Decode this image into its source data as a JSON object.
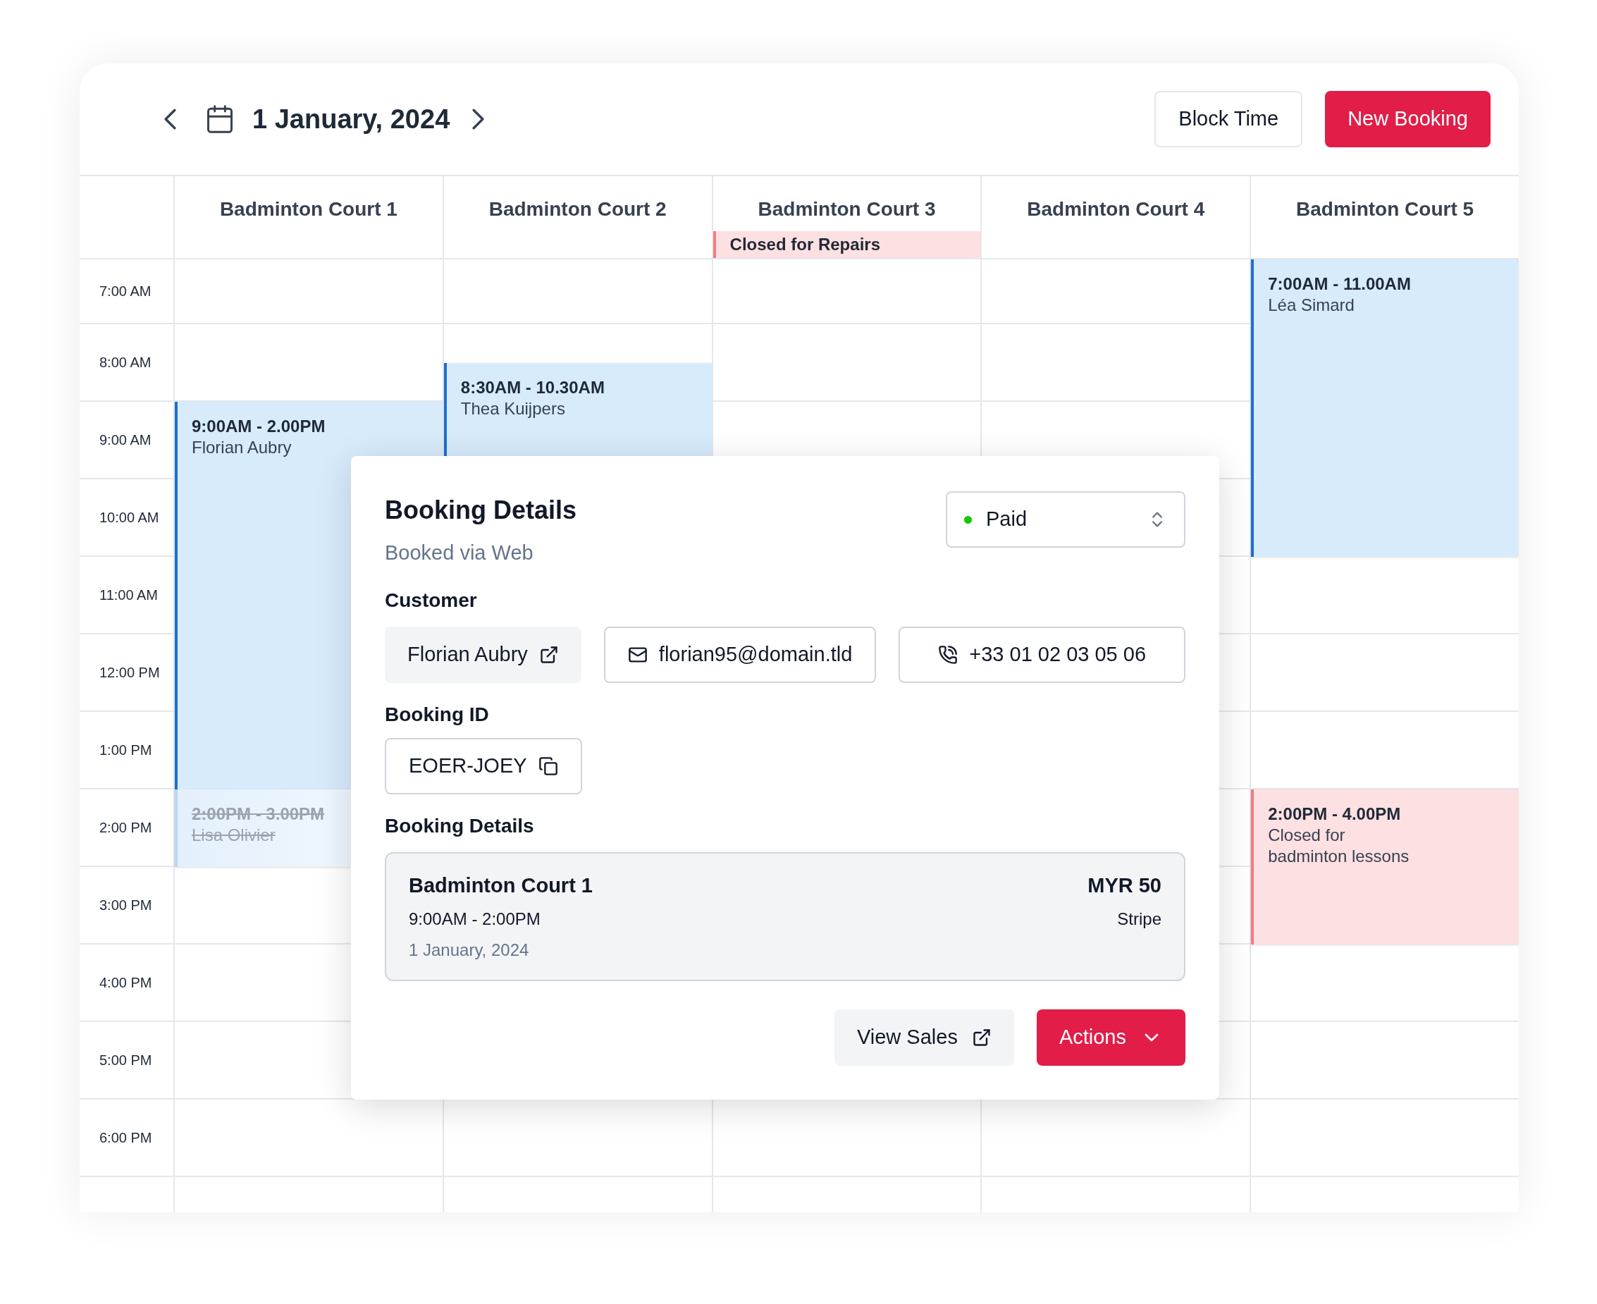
{
  "header": {
    "date": "1 January, 2024",
    "buttons": [
      {
        "label": "Block Time",
        "kind": "secondary"
      },
      {
        "label": "New Booking",
        "kind": "primary"
      }
    ]
  },
  "courts": [
    {
      "name": "Badminton Court 1",
      "bookings": [
        {
          "kind": "booking",
          "time": "9:00AM - 2.00PM",
          "name": "Florian Aubry"
        },
        {
          "kind": "cancelled",
          "time": "2:00PM - 3.00PM",
          "name": "Lisa Olivier"
        }
      ]
    },
    {
      "name": "Badminton Court 2",
      "bookings": [
        {
          "kind": "booking",
          "time": "8:30AM - 10.30AM",
          "name": "Thea Kuijpers"
        }
      ]
    },
    {
      "name": "Badminton Court 3",
      "notice": "Closed for Repairs"
    },
    {
      "name": "Badminton Court 4"
    },
    {
      "name": "Badminton Court 5",
      "bookings": [
        {
          "kind": "booking",
          "time": "7:00AM - 11.00AM",
          "name": "Léa Simard"
        },
        {
          "kind": "closed",
          "time": "2:00PM - 4.00PM",
          "name": "Closed for badminton lessons"
        }
      ]
    }
  ],
  "times": [
    "7:00 AM",
    "8:00 AM",
    "9:00 AM",
    "10:00 AM",
    "11:00 AM",
    "12:00 PM",
    "1:00 PM",
    "2:00 PM",
    "3:00 PM",
    "4:00 PM",
    "5:00 PM",
    "6:00 PM"
  ],
  "booking_details": {
    "title": "Booking Details",
    "source": "Booked via Web",
    "status": "Paid",
    "customer_label": "Customer",
    "customer": {
      "name": "Florian Aubry",
      "email": "florian95@domain.tld",
      "phone": "+33 01 02 03 05 06"
    },
    "booking_id_label": "Booking ID",
    "booking_id": "EOER-JOEY",
    "details_label": "Booking Details",
    "item": {
      "court": "Badminton Court 1",
      "time": "9:00AM - 2:00PM",
      "date": "1 January, 2024",
      "price": "MYR 50",
      "method": "Stripe"
    },
    "buttons": [
      {
        "label": "View Sales",
        "kind": "secondary"
      },
      {
        "label": "Actions",
        "kind": "primary"
      }
    ]
  }
}
